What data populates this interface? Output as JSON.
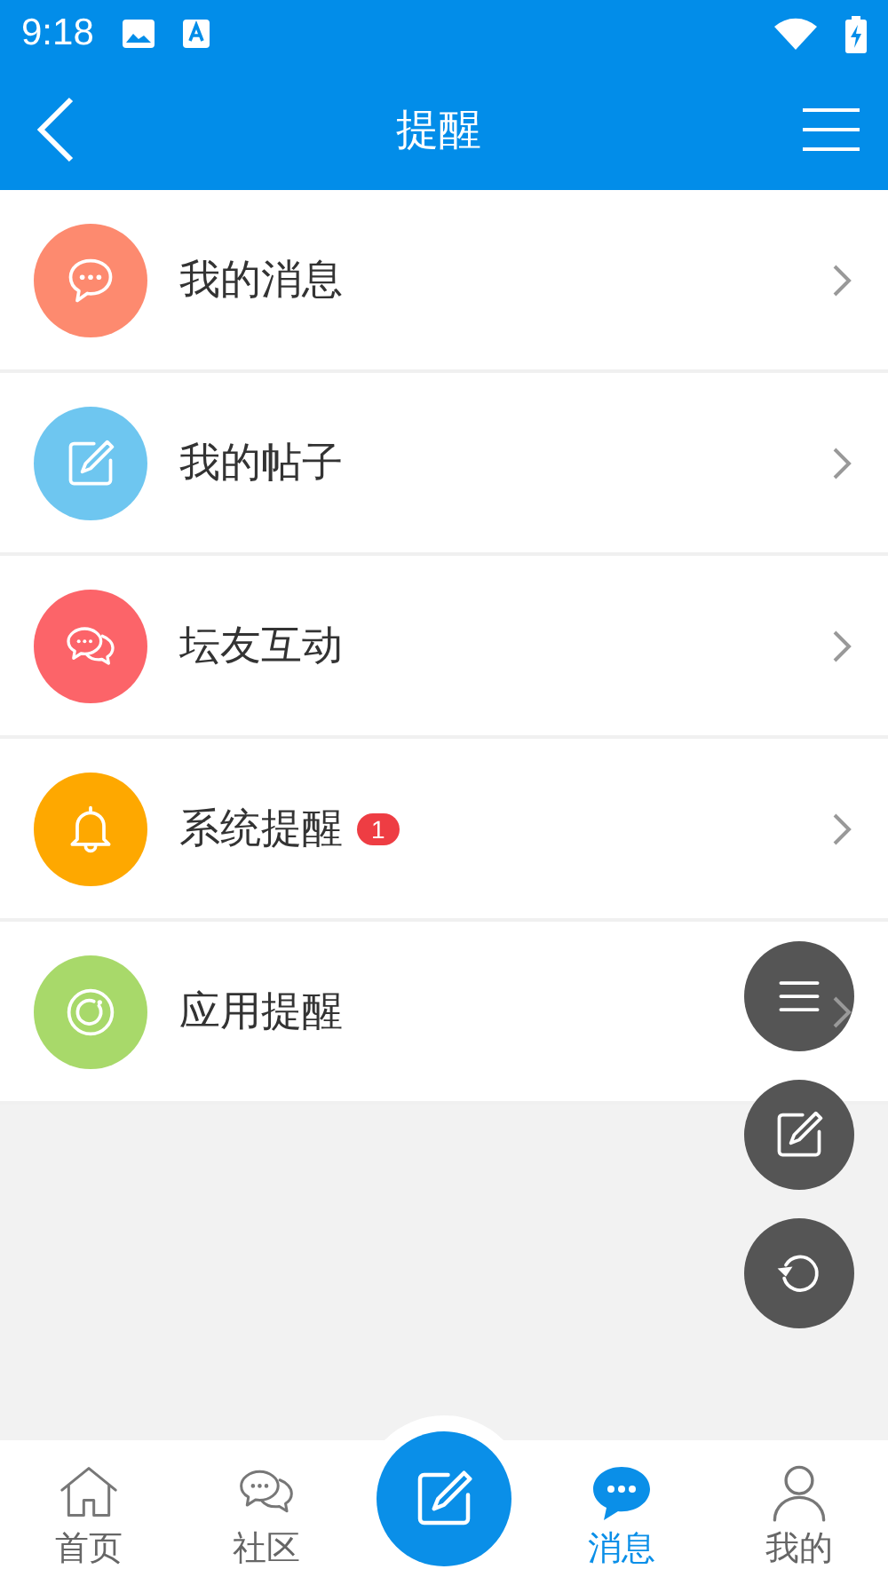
{
  "status_bar": {
    "time": "9:18"
  },
  "header": {
    "title": "提醒"
  },
  "rows": [
    {
      "kind": "chat",
      "color": "#fd8a6f",
      "label": "我的消息"
    },
    {
      "kind": "edit",
      "color": "#6ec6f0",
      "label": "我的帖子"
    },
    {
      "kind": "chats",
      "color": "#fc6469",
      "label": "坛友互动"
    },
    {
      "kind": "bell",
      "color": "#fea800",
      "label": "系统提醒",
      "badge": "1"
    },
    {
      "kind": "ring",
      "color": "#a8d96a",
      "label": "应用提醒"
    }
  ],
  "fabs": [
    {
      "kind": "menu"
    },
    {
      "kind": "edit"
    },
    {
      "kind": "refresh"
    }
  ],
  "nav": [
    {
      "kind": "home",
      "label": "首页",
      "selected": false
    },
    {
      "kind": "chats",
      "label": "社区",
      "selected": false
    },
    {
      "kind": "center"
    },
    {
      "kind": "chat",
      "label": "消息",
      "selected": true
    },
    {
      "kind": "user",
      "label": "我的",
      "selected": false
    }
  ]
}
